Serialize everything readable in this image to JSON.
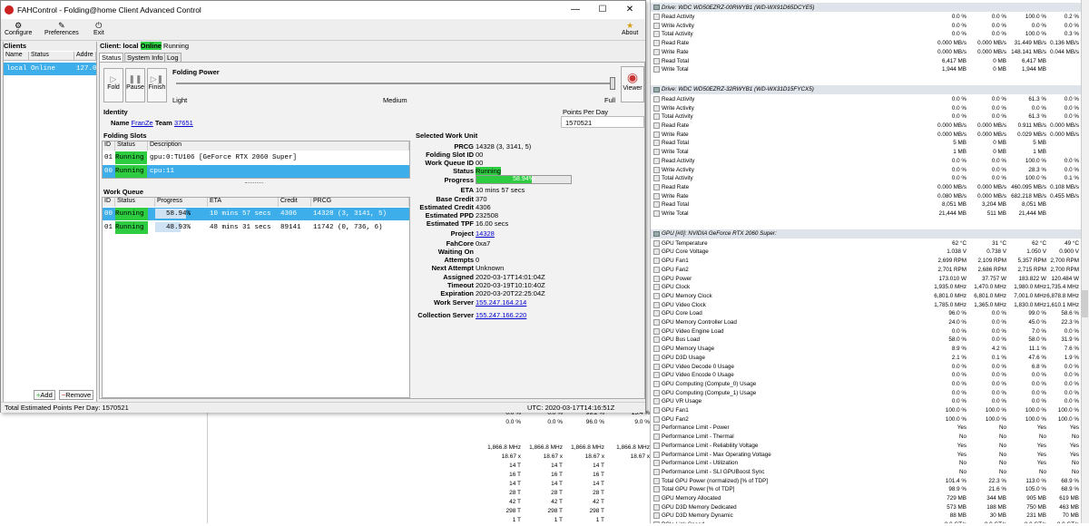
{
  "window": {
    "title": "FAHControl - Folding@home Client Advanced Control",
    "minimize": "—",
    "maximize": "☐",
    "close": "✕"
  },
  "toolbar": {
    "configure": "Configure",
    "preferences": "Preferences",
    "exit": "Exit",
    "about": "About"
  },
  "clients": {
    "header": "Clients",
    "columns": [
      "Name",
      "Status",
      "Addre"
    ],
    "row": {
      "name": "local",
      "status": "Online",
      "address": "127.0"
    },
    "add": "Add",
    "remove": "Remove"
  },
  "client_title": {
    "prefix": "Client: local",
    "status": "Online",
    "state": "Running"
  },
  "tabs": [
    "Status",
    "System Info",
    "Log"
  ],
  "controls": {
    "fold": "Fold",
    "pause": "Pause",
    "finish": "Finish",
    "folding_power": "Folding Power",
    "light": "Light",
    "medium": "Medium",
    "full": "Full",
    "viewer": "Viewer",
    "power_level": 1.0
  },
  "identity": {
    "header": "Identity",
    "name_label": "Name",
    "name": "FranZe",
    "team_label": "Team",
    "team": "37651",
    "ppd_label": "Points Per Day",
    "ppd": "1570521"
  },
  "folding_slots": {
    "header": "Folding Slots",
    "columns": [
      "ID",
      "Status",
      "Description"
    ],
    "rows": [
      {
        "id": "01",
        "status": "Running",
        "desc": "gpu:0:TU106 [GeForce RTX 2060 Super]"
      },
      {
        "id": "00",
        "status": "Running",
        "desc": "cpu:11"
      }
    ]
  },
  "work_queue": {
    "header": "Work Queue",
    "columns": [
      "ID",
      "Status",
      "Progress",
      "ETA",
      "Credit",
      "PRCG"
    ],
    "rows": [
      {
        "id": "00",
        "status": "Running",
        "progress": "58.94%",
        "progress_value": 58.94,
        "eta": "10 mins 57 secs",
        "credit": "4306",
        "prcg": "14328 (3, 3141, 5)"
      },
      {
        "id": "01",
        "status": "Running",
        "progress": "48.93%",
        "progress_value": 48.93,
        "eta": "48 mins 31 secs",
        "credit": "89141",
        "prcg": "11742 (0, 736, 6)"
      }
    ]
  },
  "selected_wu": {
    "header": "Selected Work Unit",
    "labels": [
      "PRCG",
      "Folding Slot ID",
      "Work Queue ID",
      "Status",
      "Progress",
      "ETA",
      "Base Credit",
      "Estimated Credit",
      "Estimated PPD",
      "Estimated TPF",
      "Project",
      "FahCore",
      "Waiting On",
      "Attempts",
      "Next Attempt",
      "Assigned",
      "Timeout",
      "Expiration",
      "Work Server",
      "Collection Server"
    ],
    "values": {
      "prcg": "14328 (3, 3141, 5)",
      "slot": "00",
      "queue": "00",
      "status": "Running",
      "progress": "58.94%",
      "progress_value": 58.94,
      "eta": "10 mins 57 secs",
      "base_credit": "370",
      "est_credit": "4306",
      "est_ppd": "232508",
      "est_tpf": "16.00 secs",
      "project": "14328",
      "fahcore": "0xa7",
      "waiting": "",
      "attempts": "0",
      "next_attempt": "Unknown",
      "assigned": "2020-03-17T14:01:04Z",
      "timeout": "2020-03-19T10:10:40Z",
      "expiration": "2020-03-20T22:25:04Z",
      "work_server": "155.247.164.214",
      "collection_server": "155.247.166.220"
    }
  },
  "status_bar": {
    "left": "Total Estimated Points Per Day: 1570521",
    "utc": "UTC: 2020-03-17T14:16:51Z"
  },
  "bg_rows": [
    [
      "0.0 %",
      "0.0 %",
      "99.2 %",
      "15.4 %"
    ],
    [
      "0.0 %",
      "0.0 %",
      "96.0 %",
      "9.0 %"
    ],
    [
      "1,866.8 MHz",
      "1,866.8 MHz",
      "1,866.8 MHz",
      "1,866.8 MHz"
    ],
    [
      "18.67 x",
      "18.67 x",
      "18.67 x",
      "18.67 x"
    ],
    [
      "14 T",
      "14 T",
      "14 T",
      ""
    ],
    [
      "16 T",
      "16 T",
      "16 T",
      ""
    ],
    [
      "14 T",
      "14 T",
      "14 T",
      ""
    ],
    [
      "28 T",
      "28 T",
      "28 T",
      ""
    ],
    [
      "42 T",
      "42 T",
      "42 T",
      ""
    ],
    [
      "298 T",
      "298 T",
      "298 T",
      ""
    ],
    [
      "1 T",
      "1 T",
      "1 T",
      ""
    ]
  ],
  "sensors": {
    "drive1": {
      "header": "Drive: WDC WD50EZRZ-00RWYB1 (WD-WX91D65DCYE5)",
      "rows": [
        [
          "Read Activity",
          "0.0 %",
          "0.0 %",
          "100.0 %",
          "0.2 %"
        ],
        [
          "Write Activity",
          "0.0 %",
          "0.0 %",
          "0.0 %",
          "0.0 %"
        ],
        [
          "Total Activity",
          "0.0 %",
          "0.0 %",
          "100.0 %",
          "0.3 %"
        ],
        [
          "Read Rate",
          "0.000 MB/s",
          "0.000 MB/s",
          "31.449 MB/s",
          "0.136 MB/s"
        ],
        [
          "Write Rate",
          "0.000 MB/s",
          "0.000 MB/s",
          "148.141 MB/s",
          "0.044 MB/s"
        ],
        [
          "Read Total",
          "6,417 MB",
          "0 MB",
          "6,417 MB",
          ""
        ],
        [
          "Write Total",
          "1,944 MB",
          "0 MB",
          "1,944 MB",
          ""
        ]
      ]
    },
    "drive2": {
      "header": "Drive: WDC WD50EZRZ-32RWYB1 (WD-WX31D15FYCX5)",
      "rows": [
        [
          "Read Activity",
          "0.0 %",
          "0.0 %",
          "61.3 %",
          "0.0 %"
        ],
        [
          "Write Activity",
          "0.0 %",
          "0.0 %",
          "0.0 %",
          "0.0 %"
        ],
        [
          "Total Activity",
          "0.0 %",
          "0.0 %",
          "61.3 %",
          "0.0 %"
        ],
        [
          "Read Rate",
          "0.000 MB/s",
          "0.000 MB/s",
          "0.911 MB/s",
          "0.000 MB/s"
        ],
        [
          "Write Rate",
          "0.000 MB/s",
          "0.000 MB/s",
          "0.029 MB/s",
          "0.000 MB/s"
        ],
        [
          "Read Total",
          "5 MB",
          "0 MB",
          "5 MB",
          ""
        ],
        [
          "Write Total",
          "1 MB",
          "0 MB",
          "1 MB",
          ""
        ],
        [
          "Read Activity",
          "0.0 %",
          "0.0 %",
          "100.0 %",
          "0.0 %"
        ],
        [
          "Write Activity",
          "0.0 %",
          "0.0 %",
          "28.3 %",
          "0.0 %"
        ],
        [
          "Total Activity",
          "0.0 %",
          "0.0 %",
          "100.0 %",
          "0.1 %"
        ],
        [
          "Read Rate",
          "0.000 MB/s",
          "0.000 MB/s",
          "460.095 MB/s",
          "0.108 MB/s"
        ],
        [
          "Write Rate",
          "0.080 MB/s",
          "0.000 MB/s",
          "682.218 MB/s",
          "0.455 MB/s"
        ],
        [
          "Read Total",
          "8,051 MB",
          "3,204 MB",
          "8,051 MB",
          ""
        ],
        [
          "Write Total",
          "21,444 MB",
          "511 MB",
          "21,444 MB",
          ""
        ]
      ]
    },
    "gpu": {
      "header": "GPU [#0]: NVIDIA GeForce RTX 2060 Super:",
      "rows": [
        [
          "GPU Temperature",
          "62 °C",
          "31 °C",
          "62 °C",
          "49 °C"
        ],
        [
          "GPU Core Voltage",
          "1.038 V",
          "0.738 V",
          "1.050 V",
          "0.900 V"
        ],
        [
          "GPU Fan1",
          "2,699 RPM",
          "2,109 RPM",
          "5,357 RPM",
          "2,700 RPM"
        ],
        [
          "GPU Fan2",
          "2,701 RPM",
          "2,686 RPM",
          "2,715 RPM",
          "2,700 RPM"
        ],
        [
          "GPU Power",
          "173.010 W",
          "37.757 W",
          "183.822 W",
          "120.484 W"
        ],
        [
          "GPU Clock",
          "1,935.0 MHz",
          "1,470.0 MHz",
          "1,980.0 MHz",
          "1,735.4 MHz"
        ],
        [
          "GPU Memory Clock",
          "6,801.0 MHz",
          "6,801.0 MHz",
          "7,001.0 MHz",
          "6,878.8 MHz"
        ],
        [
          "GPU Video Clock",
          "1,785.0 MHz",
          "1,365.0 MHz",
          "1,830.0 MHz",
          "1,610.1 MHz"
        ],
        [
          "GPU Core Load",
          "96.0 %",
          "0.0 %",
          "99.0 %",
          "58.6 %"
        ],
        [
          "GPU Memory Controller Load",
          "24.0 %",
          "0.0 %",
          "45.0 %",
          "22.3 %"
        ],
        [
          "GPU Video Engine Load",
          "0.0 %",
          "0.0 %",
          "7.0 %",
          "0.0 %"
        ],
        [
          "GPU Bus Load",
          "58.0 %",
          "0.0 %",
          "58.0 %",
          "31.9 %"
        ],
        [
          "GPU Memory Usage",
          "8.9 %",
          "4.2 %",
          "11.1 %",
          "7.6 %"
        ],
        [
          "GPU D3D Usage",
          "2.1 %",
          "0.1 %",
          "47.6 %",
          "1.9 %"
        ],
        [
          "GPU Video Decode 0 Usage",
          "0.0 %",
          "0.0 %",
          "6.8 %",
          "0.0 %"
        ],
        [
          "GPU Video Encode 0 Usage",
          "0.0 %",
          "0.0 %",
          "0.0 %",
          "0.0 %"
        ],
        [
          "GPU Computing (Compute_0) Usage",
          "0.0 %",
          "0.0 %",
          "0.0 %",
          "0.0 %"
        ],
        [
          "GPU Computing (Compute_1) Usage",
          "0.0 %",
          "0.0 %",
          "0.0 %",
          "0.0 %"
        ],
        [
          "GPU VR Usage",
          "0.0 %",
          "0.0 %",
          "0.0 %",
          "0.0 %"
        ],
        [
          "GPU Fan1",
          "100.0 %",
          "100.0 %",
          "100.0 %",
          "100.0 %"
        ],
        [
          "GPU Fan2",
          "100.0 %",
          "100.0 %",
          "100.0 %",
          "100.0 %"
        ],
        [
          "Performance Limit - Power",
          "Yes",
          "No",
          "Yes",
          "Yes"
        ],
        [
          "Performance Limit - Thermal",
          "No",
          "No",
          "No",
          "No"
        ],
        [
          "Performance Limit - Reliability Voltage",
          "Yes",
          "No",
          "Yes",
          "Yes"
        ],
        [
          "Performance Limit - Max Operating Voltage",
          "Yes",
          "No",
          "Yes",
          "Yes"
        ],
        [
          "Performance Limit - Utilization",
          "No",
          "No",
          "Yes",
          "No"
        ],
        [
          "Performance Limit - SLI GPUBoost Sync",
          "No",
          "No",
          "No",
          "No"
        ],
        [
          "Total GPU Power (normalized) [% of TDP]",
          "101.4 %",
          "22.3 %",
          "113.0 %",
          "68.9 %"
        ],
        [
          "Total GPU Power [% of TDP]",
          "98.9 %",
          "21.6 %",
          "105.0 %",
          "68.9 %"
        ],
        [
          "GPU Memory Allocated",
          "729 MB",
          "344 MB",
          "905 MB",
          "619 MB"
        ],
        [
          "GPU D3D Memory Dedicated",
          "573 MB",
          "188 MB",
          "750 MB",
          "463 MB"
        ],
        [
          "GPU D3D Memory Dynamic",
          "88 MB",
          "30 MB",
          "231 MB",
          "70 MB"
        ],
        [
          "PCIe Link Speed",
          "8.0 GT/s",
          "8.0 GT/s",
          "8.0 GT/s",
          "8.0 GT/s"
        ]
      ]
    }
  }
}
